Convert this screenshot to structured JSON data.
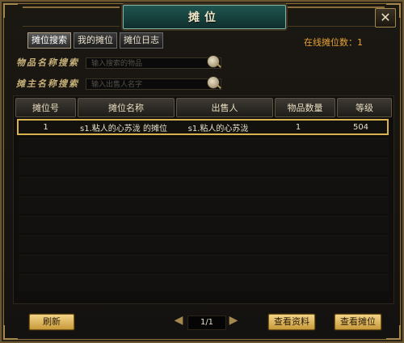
{
  "window": {
    "title": "摊位",
    "close_glyph": "✕"
  },
  "tabs": [
    {
      "label": "摊位搜索"
    },
    {
      "label": "我的摊位"
    },
    {
      "label": "摊位日志"
    }
  ],
  "online": {
    "text": "在线摊位数：1"
  },
  "search": {
    "item_label": "物品名称搜索",
    "item_placeholder": "输入搜索的物品",
    "seller_label": "摊主名称搜索",
    "seller_placeholder": "输入出售人名字"
  },
  "table": {
    "headers": [
      "摊位号",
      "摊位名称",
      "出售人",
      "物品数量",
      "等级"
    ],
    "rows": [
      {
        "id": "1",
        "name": "s1.粘人的心苏泷 的摊位",
        "seller": "s1.粘人的心苏泷",
        "count": "1",
        "level": "504"
      }
    ]
  },
  "footer": {
    "refresh": "刷新",
    "page": "1/1",
    "view_info": "查看资料",
    "view_stall": "查看摊位"
  },
  "icons": {
    "search": "magnifier-icon",
    "close": "close-icon",
    "prev": "triangle-left-icon",
    "next": "triangle-right-icon"
  }
}
